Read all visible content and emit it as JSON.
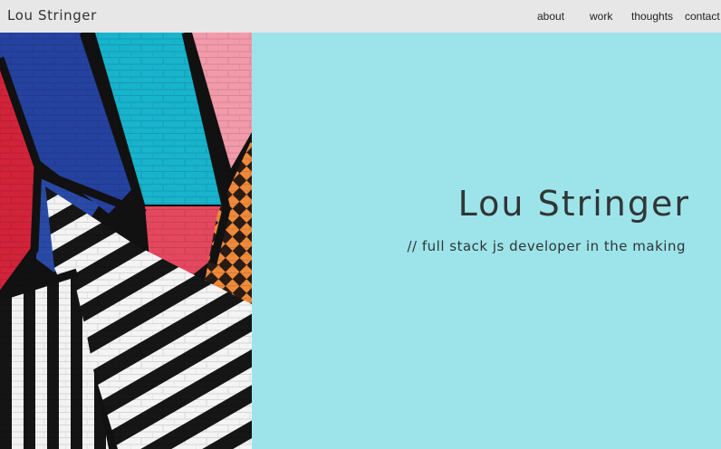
{
  "header": {
    "brand": "Lou Stringer",
    "nav": [
      {
        "label": "about"
      },
      {
        "label": "work"
      },
      {
        "label": "thoughts"
      },
      {
        "label": "contact"
      }
    ]
  },
  "hero": {
    "title": "Lou Stringer",
    "subtitle": "// full stack js developer in the making"
  },
  "colors": {
    "nav_background": "#e7e7e7",
    "hero_background": "#9de4ea",
    "text": "#303636"
  },
  "image": {
    "subject": "colorful geometric mural on brick wall"
  }
}
